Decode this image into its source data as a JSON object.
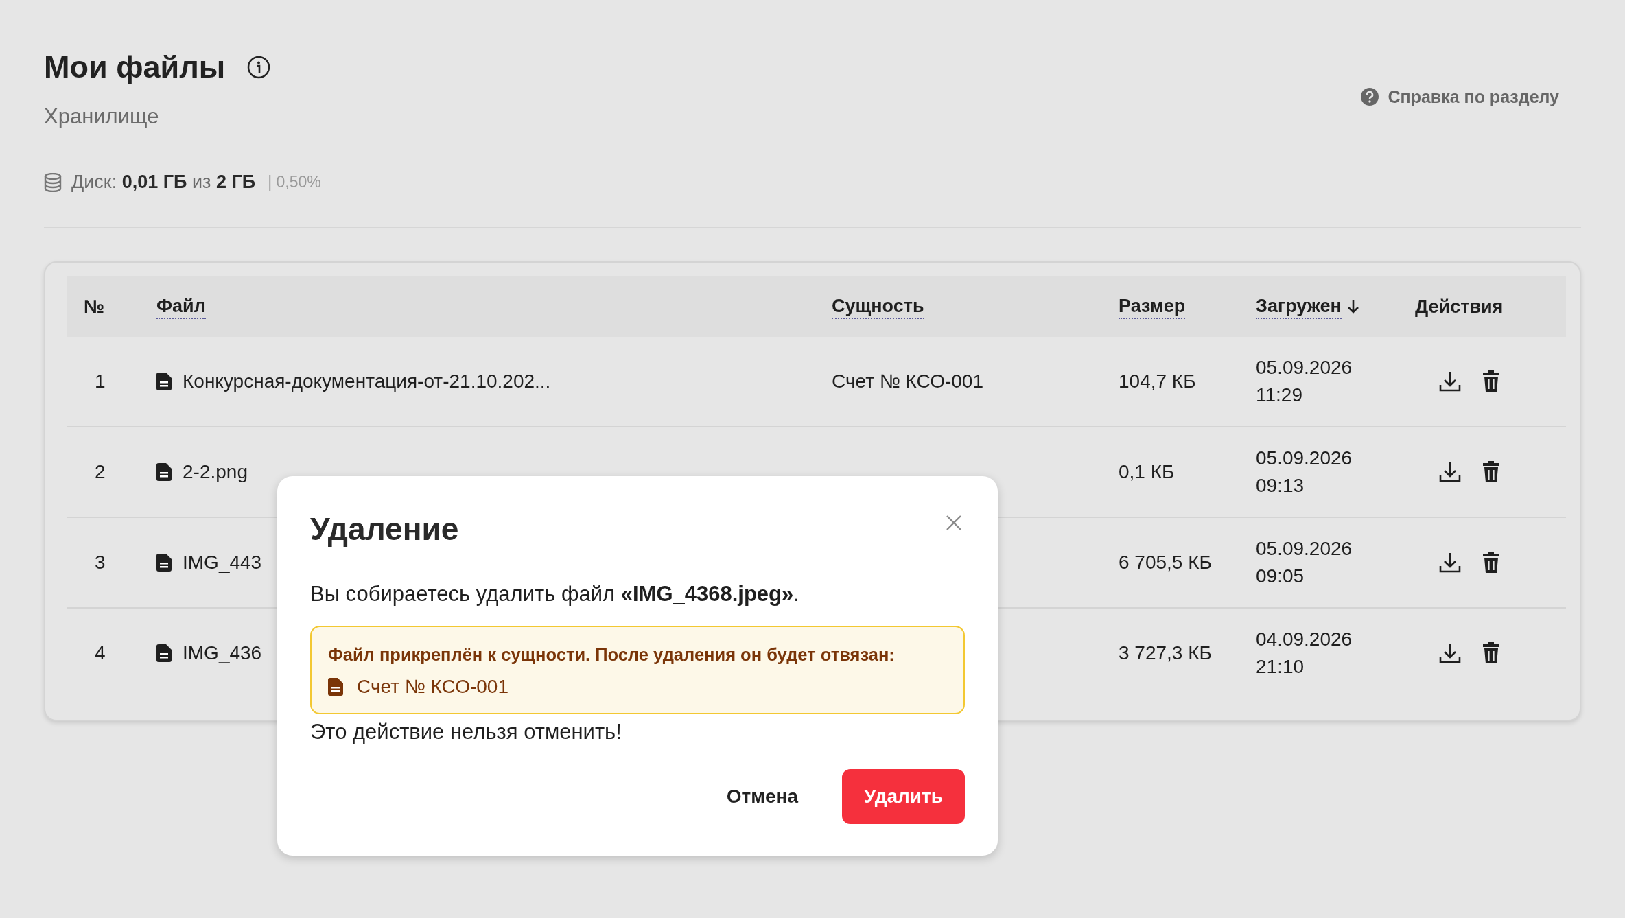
{
  "page": {
    "title": "Мои файлы",
    "subtitle": "Хранилище",
    "help_link": "Справка по разделу",
    "disk": {
      "label": "Диск:",
      "used": "0,01 ГБ",
      "of": "из",
      "total": "2 ГБ",
      "percent": "| 0,50%"
    }
  },
  "table": {
    "columns": [
      {
        "label": "№",
        "sortable": false
      },
      {
        "label": "Файл",
        "sortable": true,
        "sorted": false
      },
      {
        "label": "Сущность",
        "sortable": true,
        "sorted": false
      },
      {
        "label": "Размер",
        "sortable": true,
        "sorted": false
      },
      {
        "label": "Загружен",
        "sortable": true,
        "sorted": true
      },
      {
        "label": "Действия",
        "sortable": false
      }
    ],
    "rows": [
      {
        "number": "1",
        "file": "Конкурсная-документация-от-21.10.202...",
        "entity": "Счет № КСО-001",
        "size": "104,7 КБ",
        "uploaded": "05.09.2026 11:29"
      },
      {
        "number": "2",
        "file": "2-2.png",
        "size": "0,1 КБ",
        "uploaded": "05.09.2026 09:13"
      },
      {
        "number": "3",
        "file": "IMG_443",
        "size": "6 705,5 КБ",
        "uploaded": "05.09.2026 09:05"
      },
      {
        "number": "4",
        "file": "IMG_436",
        "size": "3 727,3 КБ",
        "uploaded": "04.09.2026 21:10"
      }
    ]
  },
  "dialog": {
    "title": "Удаление",
    "message": "Вы собираетесь удалить файл **«IMG_4368.jpeg»**.",
    "warning": {
      "text": "Файл прикреплён к сущности. После удаления он будет отвязан:",
      "entity": "Счет № КСО-001"
    },
    "note": "Это действие нельзя отменить!",
    "cancel": "Отмена",
    "confirm": "Удалить"
  }
}
